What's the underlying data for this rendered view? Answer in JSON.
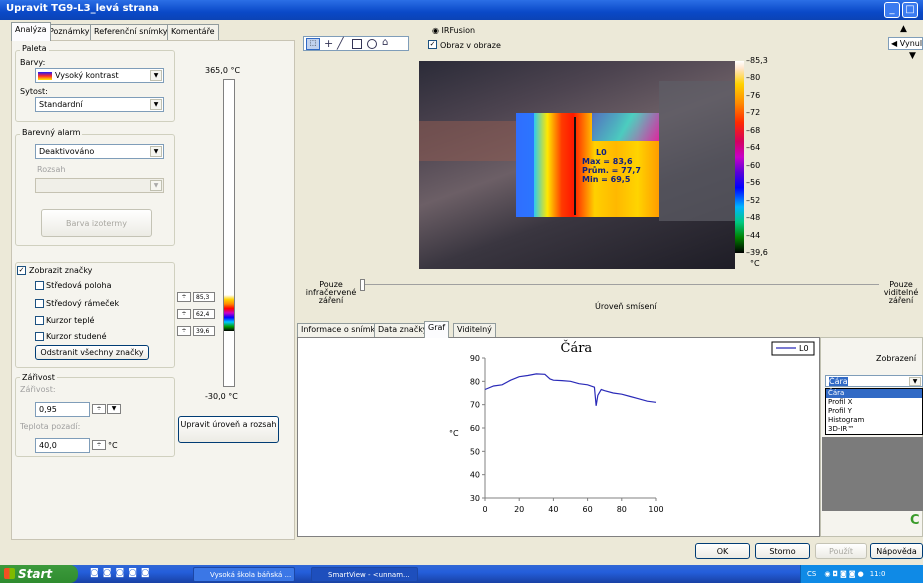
{
  "window": {
    "title": "Upravit TG9-L3_levá strana"
  },
  "tabs": [
    "Analýza",
    "Poznámky",
    "Referenční snímky",
    "Komentáře"
  ],
  "palette": {
    "group": "Paleta",
    "colors_label": "Barvy:",
    "colors_value": "Vysoký kontrast",
    "saturation_label": "Sytost:",
    "saturation_value": "Standardní"
  },
  "alarm": {
    "group": "Barevný alarm",
    "value": "Deaktivováno",
    "range_label": "Rozsah",
    "isotherm_button": "Barva izotermy"
  },
  "markers": {
    "show_label": "Zobrazit značky",
    "items": [
      "Středová poloha",
      "Středový rámeček",
      "Kurzor teplé",
      "Kurzor studené"
    ],
    "remove_button": "Odstranit všechny značky"
  },
  "emissivity": {
    "group": "Zářivost",
    "emissivity_label": "Zářivost:",
    "emissivity_value": "0,95",
    "bg_label": "Teplota pozadí:",
    "bg_value": "40,0",
    "bg_unit": "°C"
  },
  "scale": {
    "top": "365,0 °C",
    "bottom": "-30,0 °C",
    "marker_values": [
      "85,3",
      "62,4",
      "39,6"
    ],
    "adjust_button": "Upravit úroveň a rozsah"
  },
  "image": {
    "irfusion_label": "IRFusion",
    "pip_label": "Obraz v obraze",
    "palette_ticks": [
      "85,3",
      "80",
      "76",
      "72",
      "68",
      "64",
      "60",
      "56",
      "52",
      "48",
      "44",
      "39,6"
    ],
    "palette_unit": "°C",
    "line_label": "L0",
    "line_max": "Max = 83,6",
    "line_avg": "Prům. = 77,7",
    "line_min": "Min = 69,5"
  },
  "fusion": {
    "left": "Pouze infračervené záření",
    "center": "Úroveň smísení",
    "right": "Pouze viditelné záření",
    "tool_label": "Vynul"
  },
  "lower_tabs": [
    "Informace o snímku",
    "Data značky",
    "Graf",
    "Viditelný"
  ],
  "display": {
    "label": "Zobrazení",
    "selected": "Čára",
    "options": [
      "Čára",
      "Profil X",
      "Profil Y",
      "Histogram",
      "3D-IR™"
    ]
  },
  "buttons": {
    "ok": "OK",
    "cancel": "Storno",
    "apply": "Použít",
    "help": "Nápověda"
  },
  "taskbar": {
    "start": "Start",
    "tasks": [
      "Vysoká škola báňská ...",
      "SmartView - <unnam..."
    ],
    "tray_cs": "CS",
    "clock": "11:0"
  },
  "chart_data": {
    "type": "line",
    "title": "Čára",
    "xlabel": "",
    "ylabel": "°C",
    "xlim": [
      0,
      100
    ],
    "ylim": [
      30,
      90
    ],
    "xticks": [
      0,
      20,
      40,
      60,
      80,
      100
    ],
    "yticks": [
      30,
      40,
      50,
      60,
      70,
      80,
      90
    ],
    "grid": false,
    "legend_position": "top-right",
    "series": [
      {
        "name": "L0",
        "color": "#2a2ab8",
        "x": [
          0,
          5,
          10,
          15,
          20,
          25,
          30,
          35,
          38,
          40,
          45,
          50,
          55,
          60,
          64,
          65,
          66,
          68,
          70,
          75,
          80,
          85,
          90,
          95,
          100
        ],
        "y": [
          76.5,
          78,
          78.5,
          80.5,
          82,
          82.5,
          83.2,
          83,
          81,
          80.5,
          80.3,
          80,
          79,
          78.5,
          77.5,
          69.5,
          74,
          76.5,
          76,
          75,
          74.5,
          73.5,
          72.5,
          71.5,
          71
        ]
      }
    ]
  }
}
